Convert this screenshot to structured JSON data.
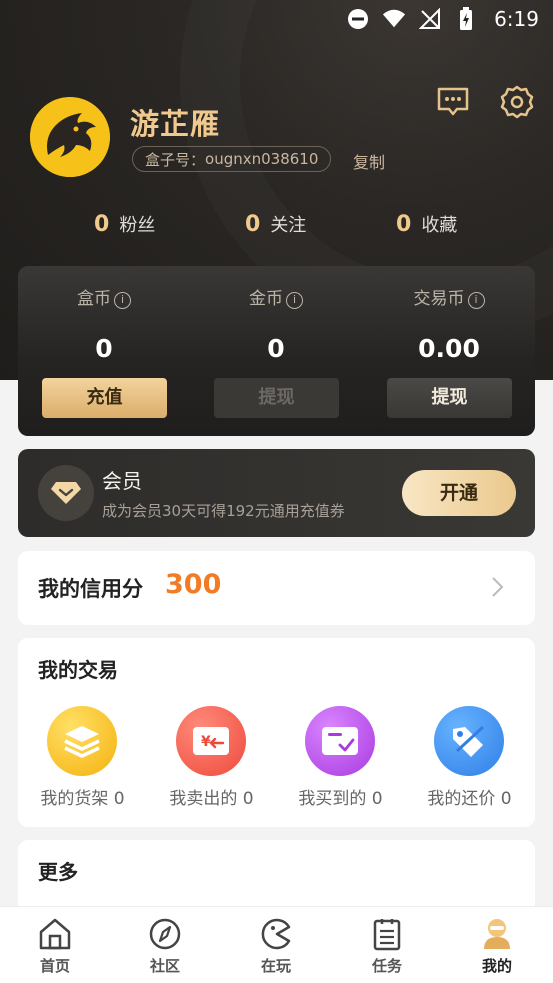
{
  "status_bar": {
    "time": "6:19"
  },
  "profile": {
    "username": "游芷雁",
    "box_id_label": "盒子号：",
    "box_id_value": "ougnxn038610",
    "copy_label": "复制"
  },
  "stats": [
    {
      "num": "0",
      "label": "粉丝"
    },
    {
      "num": "0",
      "label": "关注"
    },
    {
      "num": "0",
      "label": "收藏"
    }
  ],
  "wallet": [
    {
      "title": "盒币",
      "value": "0",
      "button": "充值"
    },
    {
      "title": "金币",
      "value": "0",
      "button": "提现"
    },
    {
      "title": "交易币",
      "value": "0.00",
      "button": "提现"
    }
  ],
  "member": {
    "title": "会员",
    "subtitle": "成为会员30天可得192元通用充值券",
    "button": "开通"
  },
  "credit": {
    "label": "我的信用分",
    "value": "300"
  },
  "trade": {
    "title": "我的交易",
    "items": [
      {
        "label": "我的货架 0",
        "icon": "shelf-icon",
        "color": "#f7b718"
      },
      {
        "label": "我卖出的 0",
        "icon": "sold-icon",
        "color": "#f2574a"
      },
      {
        "label": "我买到的 0",
        "icon": "bought-icon",
        "color": "#b146e0"
      },
      {
        "label": "我的还价 0",
        "icon": "bargain-icon",
        "color": "#3b8af0"
      }
    ]
  },
  "more": {
    "title": "更多"
  },
  "bottom_nav": [
    {
      "label": "首页",
      "icon": "home-icon"
    },
    {
      "label": "社区",
      "icon": "compass-icon"
    },
    {
      "label": "在玩",
      "icon": "play-icon"
    },
    {
      "label": "任务",
      "icon": "task-icon"
    },
    {
      "label": "我的",
      "icon": "profile-icon",
      "active": true
    }
  ],
  "colors": {
    "gold": "#f0c98e",
    "accent_orange": "#f37b26",
    "dark_bg": "#262422"
  }
}
